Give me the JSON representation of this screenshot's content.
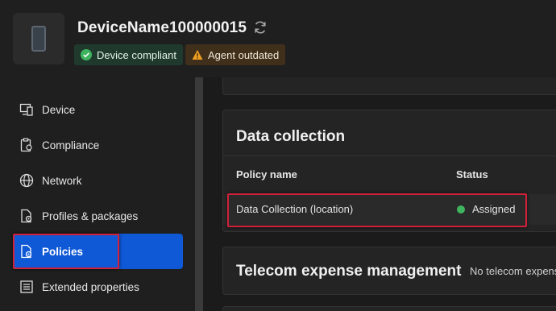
{
  "header": {
    "device_name": "DeviceName100000015",
    "badges": {
      "compliant": "Device compliant",
      "agent": "Agent outdated"
    }
  },
  "sidebar": {
    "items": [
      {
        "label": "Device",
        "icon": "device-icon"
      },
      {
        "label": "Compliance",
        "icon": "compliance-icon"
      },
      {
        "label": "Network",
        "icon": "globe-icon"
      },
      {
        "label": "Profiles & packages",
        "icon": "profiles-icon"
      },
      {
        "label": "Policies",
        "icon": "policies-icon",
        "active": true
      },
      {
        "label": "Extended properties",
        "icon": "extended-properties-icon"
      }
    ]
  },
  "main": {
    "data_collection": {
      "title": "Data collection",
      "columns": [
        "Policy name",
        "Status"
      ],
      "rows": [
        {
          "policy": "Data Collection (location)",
          "status": "Assigned"
        }
      ]
    },
    "telecom": {
      "title": "Telecom expense management",
      "note": "No telecom expens"
    }
  },
  "colors": {
    "accent": "#0f58d6",
    "highlight": "#d0213b",
    "success": "#3fb45f",
    "warning": "#f0a020"
  }
}
